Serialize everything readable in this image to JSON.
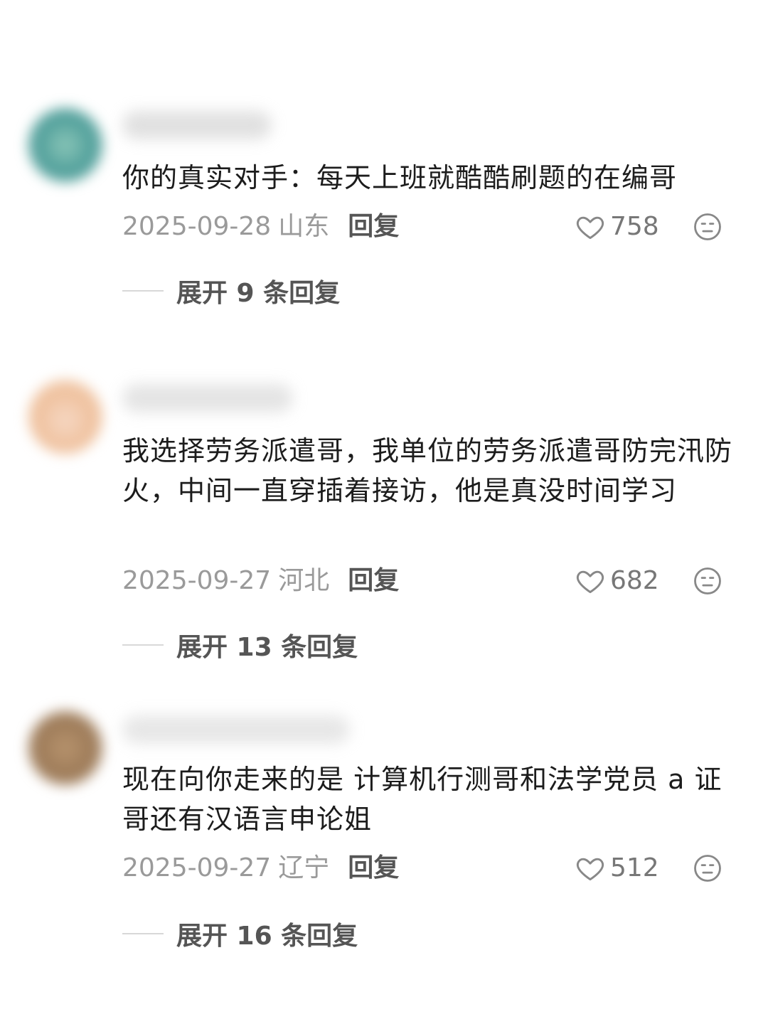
{
  "comments": [
    {
      "text": "你的真实对手：每天上班就酷酷刷题的在编哥",
      "date": "2025-09-28",
      "region": "山东",
      "reply_label": "回复",
      "likes": "758",
      "expand_label": "展开 9 条回复",
      "avatar_color": "#5fa8a0"
    },
    {
      "text": "我选择劳务派遣哥，我单位的劳务派遣哥防完汛防火，中间一直穿插着接访，他是真没时间学习",
      "date": "2025-09-27",
      "region": "河北",
      "reply_label": "回复",
      "likes": "682",
      "expand_label": "展开 13 条回复",
      "avatar_color": "#f1c9a8"
    },
    {
      "text": "现在向你走来的是 计算机行测哥和法学党员 a 证哥还有汉语言申论姐",
      "date": "2025-09-27",
      "region": "辽宁",
      "reply_label": "回复",
      "likes": "512",
      "expand_label": "展开 16 条回复",
      "avatar_color": "#a68562"
    }
  ]
}
